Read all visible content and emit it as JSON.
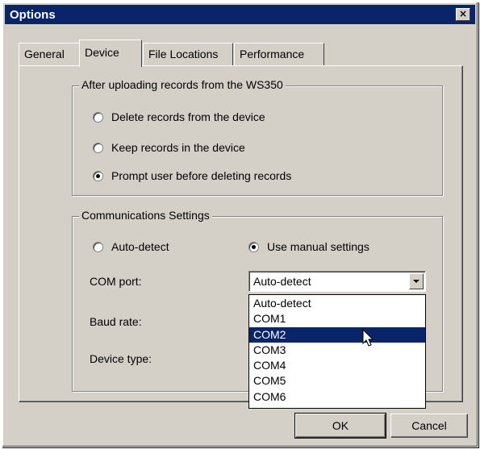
{
  "window": {
    "title": "Options",
    "close_label": "×"
  },
  "tabs": [
    {
      "label": "General"
    },
    {
      "label": "Device"
    },
    {
      "label": "File Locations"
    },
    {
      "label": "Performance"
    }
  ],
  "upload_group": {
    "legend": "After uploading records from the WS350",
    "options": [
      {
        "label": "Delete records from the device",
        "checked": false
      },
      {
        "label": "Keep records in the device",
        "checked": false
      },
      {
        "label": "Prompt user before deleting records",
        "checked": true
      }
    ]
  },
  "comm_group": {
    "legend": "Communications Settings",
    "auto_detect_label": "Auto-detect",
    "manual_label": "Use manual settings",
    "com_port_label": "COM port:",
    "baud_rate_label": "Baud rate:",
    "device_type_label": "Device type:",
    "com_port_value": "Auto-detect",
    "com_port_options": [
      "Auto-detect",
      "COM1",
      "COM2",
      "COM3",
      "COM4",
      "COM5",
      "COM6"
    ],
    "highlighted_option": "COM2"
  },
  "buttons": {
    "ok": "OK",
    "cancel": "Cancel"
  }
}
